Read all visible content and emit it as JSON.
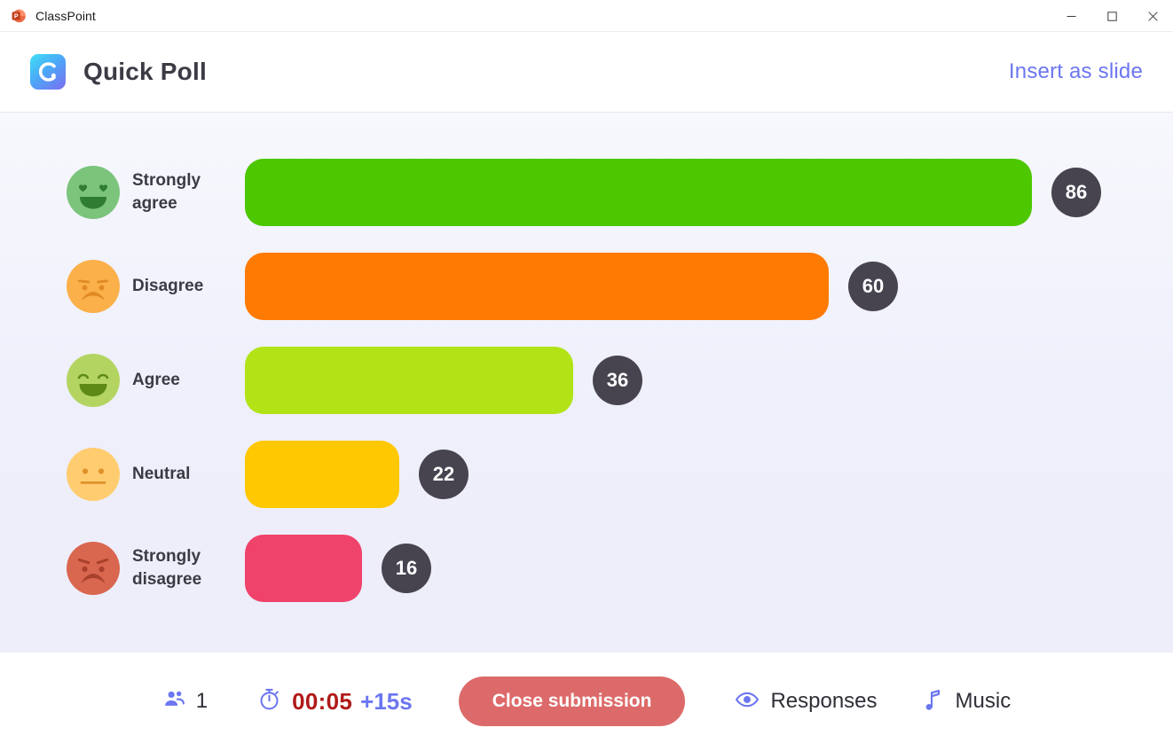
{
  "window": {
    "app_title": "ClassPoint",
    "app_icon": "powerpoint-icon",
    "minimize_label": "–",
    "maximize_label": "□",
    "close_label": "✕"
  },
  "header": {
    "logo_icon": "classpoint-logo-icon",
    "title": "Quick Poll",
    "insert_label": "Insert as slide",
    "insert_color": "#6b76f0"
  },
  "chart_data": {
    "type": "bar",
    "title": "Quick Poll",
    "orientation": "horizontal",
    "xlabel": "",
    "ylabel": "",
    "categories": [
      "Strongly agree",
      "Disagree",
      "Agree",
      "Neutral",
      "Strongly disagree"
    ],
    "values": [
      86,
      60,
      36,
      22,
      16
    ],
    "colors": [
      "#4dc700",
      "#ff7a00",
      "#b2e316",
      "#ffc800",
      "#f0436b"
    ],
    "emoji_colors": [
      "#7cc47c",
      "#fbb04a",
      "#b4d462",
      "#ffcd70",
      "#d9674f"
    ],
    "emoji_names": [
      "heart-eyes-face",
      "frowning-face",
      "smiling-face",
      "neutral-face",
      "angry-face"
    ],
    "max_value": 86,
    "grid": false,
    "legend": "none"
  },
  "footer": {
    "participants_icon": "people-icon",
    "participants_count": "1",
    "timer_icon": "stopwatch-icon",
    "timer_value": "00:05",
    "timer_add": "+15s",
    "close_submission_label": "Close submission",
    "close_submission_color": "#dd6a6a",
    "responses_icon": "eye-icon",
    "responses_label": "Responses",
    "music_icon": "music-note-icon",
    "music_label": "Music"
  }
}
